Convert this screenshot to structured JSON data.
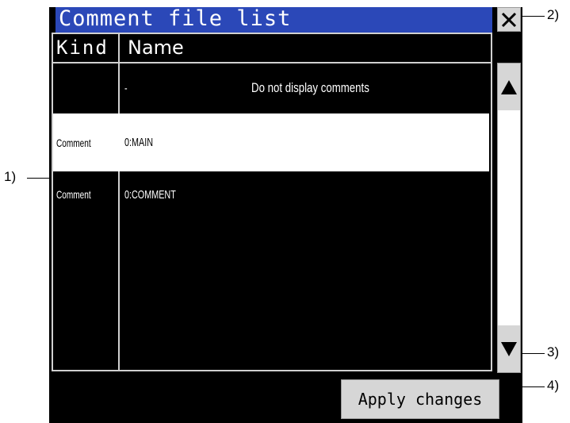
{
  "window": {
    "title": "Comment file list",
    "close_icon": "close-icon"
  },
  "list": {
    "columns": [
      "Kind",
      "Name"
    ],
    "rows": [
      {
        "kind": "",
        "name": "-",
        "description": "Do not display comments",
        "selected": false
      },
      {
        "kind": "Comment",
        "name": "0:MAIN",
        "description": "",
        "selected": true
      },
      {
        "kind": "Comment",
        "name": "0:COMMENT",
        "description": "",
        "selected": false
      }
    ]
  },
  "scrollbar": {
    "up_icon": "triangle-up-icon",
    "down_icon": "triangle-down-icon"
  },
  "footer": {
    "apply_label": "Apply changes"
  },
  "callouts": [
    "1)",
    "2)",
    "3)",
    "4)"
  ],
  "colors": {
    "title_bar": "#2b48b8",
    "panel": "#000000",
    "selected_row": "#ffffff",
    "button": "#d6d6d6"
  }
}
